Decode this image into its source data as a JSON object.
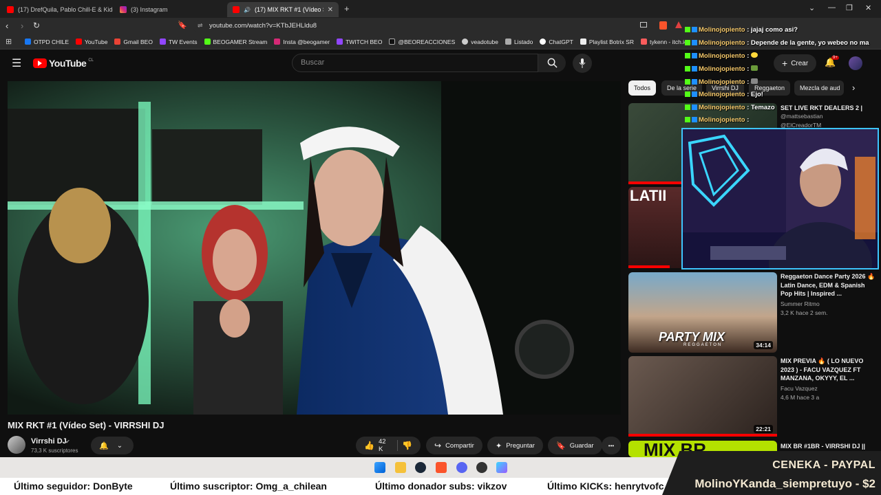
{
  "browser": {
    "tabs": [
      {
        "label": "(17) DrefQuila, Pablo Chill-E & Kidd V",
        "icon": "youtube"
      },
      {
        "label": "(3) Instagram",
        "icon": "instagram"
      },
      {
        "label": "(17) MIX RKT #1 (Vídeo Set) -",
        "icon": "youtube"
      }
    ],
    "new_tab": "+",
    "url": "youtube.com/watch?v=KTbJEHLldu8",
    "bookmarks": [
      "OTPD CHILE",
      "YouTube",
      "Gmail BEO",
      "TW Events",
      "BEOGAMER Stream",
      "Insta @beogamer",
      "TWITCH BEO",
      "@BEOREACCIONES",
      "veadotube",
      "Listado",
      "ChatGPT",
      "Playlist Botrix SR",
      "tykenn - itch.io"
    ]
  },
  "youtube": {
    "logo": "YouTube",
    "country": "CL",
    "search_placeholder": "Buscar",
    "create_label": "Crear",
    "notifications_badge": "9+",
    "chips": [
      "Todos",
      "De la serie",
      "Virrshi DJ",
      "Reggaeton",
      "Mezcla de aud"
    ],
    "video": {
      "title": "MIX RKT #1 (Vídeo Set) - VIRRSHI DJ",
      "channel": "Virrshi DJ",
      "subscribers": "73,3 K suscriptores",
      "likes": "42 K",
      "share": "Compartir",
      "ask": "Preguntar",
      "save": "Guardar",
      "more": "•••"
    },
    "recommendations": [
      {
        "title": "SET LIVE RKT DEALERS 2 |",
        "channel": "@mattsebastian",
        "extra": "@ElCreadorTM"
      },
      {
        "title": "Reggaeton Dance Party 2026 🔥 Latin Dance, EDM & Spanish Pop Hits | Inspired ...",
        "channel": "Summer Ritmo",
        "stats": "3,2 K   hace 2 sem.",
        "duration": "34:14",
        "thumb_text": "PARTY MIX",
        "thumb_sub": "REGGAETON"
      },
      {
        "title": "MIX PREVIA 🔥 ( LO NUEVO 2023 ) - FACU VAZQUEZ FT MANZANA, OKYYY, EL ...",
        "channel": "Facu Vazquez",
        "stats": "4,6 M   hace 3 a",
        "duration": "22:21"
      },
      {
        "title": "MIX BR #1BR - VIRRSHI DJ ||",
        "thumb_text": "MIX BR"
      }
    ],
    "latin_thumb_text": "LATII"
  },
  "stream_chat": [
    {
      "user": "Molinojopiento",
      "message": ": jajaj como asi?"
    },
    {
      "user": "Molinojopiento",
      "message": ": Depende de la gente, yo webeo no ma"
    },
    {
      "user": "Molinojopiento",
      "message": ":"
    },
    {
      "user": "Molinojopiento",
      "message": ":"
    },
    {
      "user": "Molinojopiento",
      "message": ":"
    },
    {
      "user": "Molinojopiento",
      "message": ": Ejo!"
    },
    {
      "user": "Molinojopiento",
      "message": ": Temazo"
    },
    {
      "user": "Molinojopiento",
      "message": ":"
    }
  ],
  "ticker": {
    "follower": "Último seguidor: DonByte",
    "subscriber": "Último suscriptor: Omg_a_chilean",
    "sub_donor": "Último donador subs: vikzov",
    "kicks": "Último KICKs: henrytvofc"
  },
  "donation": {
    "line1": "CENEKA - PAYPAL",
    "line2": "MolinoYKanda_siempretuyo - $2"
  },
  "colors": {
    "yt_red": "#ff0000",
    "webcam_border": "#3ec6ff",
    "chat_user": "#f5c86a"
  }
}
